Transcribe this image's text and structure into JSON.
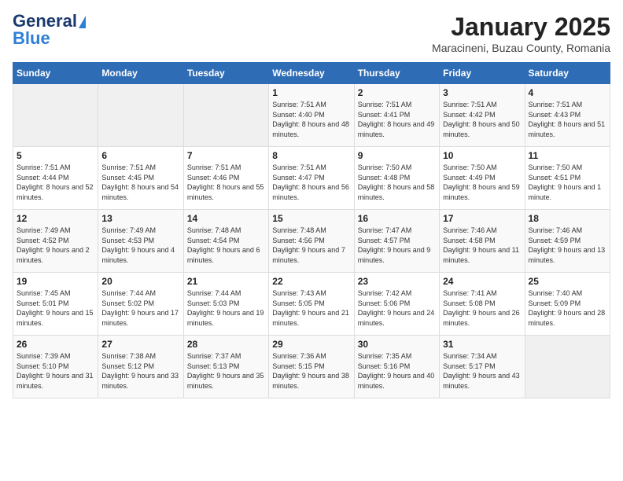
{
  "logo": {
    "text1": "General",
    "text2": "Blue"
  },
  "title": "January 2025",
  "subtitle": "Maracineni, Buzau County, Romania",
  "headers": [
    "Sunday",
    "Monday",
    "Tuesday",
    "Wednesday",
    "Thursday",
    "Friday",
    "Saturday"
  ],
  "weeks": [
    [
      {
        "day": "",
        "sunrise": "",
        "sunset": "",
        "daylight": ""
      },
      {
        "day": "",
        "sunrise": "",
        "sunset": "",
        "daylight": ""
      },
      {
        "day": "",
        "sunrise": "",
        "sunset": "",
        "daylight": ""
      },
      {
        "day": "1",
        "sunrise": "Sunrise: 7:51 AM",
        "sunset": "Sunset: 4:40 PM",
        "daylight": "Daylight: 8 hours and 48 minutes."
      },
      {
        "day": "2",
        "sunrise": "Sunrise: 7:51 AM",
        "sunset": "Sunset: 4:41 PM",
        "daylight": "Daylight: 8 hours and 49 minutes."
      },
      {
        "day": "3",
        "sunrise": "Sunrise: 7:51 AM",
        "sunset": "Sunset: 4:42 PM",
        "daylight": "Daylight: 8 hours and 50 minutes."
      },
      {
        "day": "4",
        "sunrise": "Sunrise: 7:51 AM",
        "sunset": "Sunset: 4:43 PM",
        "daylight": "Daylight: 8 hours and 51 minutes."
      }
    ],
    [
      {
        "day": "5",
        "sunrise": "Sunrise: 7:51 AM",
        "sunset": "Sunset: 4:44 PM",
        "daylight": "Daylight: 8 hours and 52 minutes."
      },
      {
        "day": "6",
        "sunrise": "Sunrise: 7:51 AM",
        "sunset": "Sunset: 4:45 PM",
        "daylight": "Daylight: 8 hours and 54 minutes."
      },
      {
        "day": "7",
        "sunrise": "Sunrise: 7:51 AM",
        "sunset": "Sunset: 4:46 PM",
        "daylight": "Daylight: 8 hours and 55 minutes."
      },
      {
        "day": "8",
        "sunrise": "Sunrise: 7:51 AM",
        "sunset": "Sunset: 4:47 PM",
        "daylight": "Daylight: 8 hours and 56 minutes."
      },
      {
        "day": "9",
        "sunrise": "Sunrise: 7:50 AM",
        "sunset": "Sunset: 4:48 PM",
        "daylight": "Daylight: 8 hours and 58 minutes."
      },
      {
        "day": "10",
        "sunrise": "Sunrise: 7:50 AM",
        "sunset": "Sunset: 4:49 PM",
        "daylight": "Daylight: 8 hours and 59 minutes."
      },
      {
        "day": "11",
        "sunrise": "Sunrise: 7:50 AM",
        "sunset": "Sunset: 4:51 PM",
        "daylight": "Daylight: 9 hours and 1 minute."
      }
    ],
    [
      {
        "day": "12",
        "sunrise": "Sunrise: 7:49 AM",
        "sunset": "Sunset: 4:52 PM",
        "daylight": "Daylight: 9 hours and 2 minutes."
      },
      {
        "day": "13",
        "sunrise": "Sunrise: 7:49 AM",
        "sunset": "Sunset: 4:53 PM",
        "daylight": "Daylight: 9 hours and 4 minutes."
      },
      {
        "day": "14",
        "sunrise": "Sunrise: 7:48 AM",
        "sunset": "Sunset: 4:54 PM",
        "daylight": "Daylight: 9 hours and 6 minutes."
      },
      {
        "day": "15",
        "sunrise": "Sunrise: 7:48 AM",
        "sunset": "Sunset: 4:56 PM",
        "daylight": "Daylight: 9 hours and 7 minutes."
      },
      {
        "day": "16",
        "sunrise": "Sunrise: 7:47 AM",
        "sunset": "Sunset: 4:57 PM",
        "daylight": "Daylight: 9 hours and 9 minutes."
      },
      {
        "day": "17",
        "sunrise": "Sunrise: 7:46 AM",
        "sunset": "Sunset: 4:58 PM",
        "daylight": "Daylight: 9 hours and 11 minutes."
      },
      {
        "day": "18",
        "sunrise": "Sunrise: 7:46 AM",
        "sunset": "Sunset: 4:59 PM",
        "daylight": "Daylight: 9 hours and 13 minutes."
      }
    ],
    [
      {
        "day": "19",
        "sunrise": "Sunrise: 7:45 AM",
        "sunset": "Sunset: 5:01 PM",
        "daylight": "Daylight: 9 hours and 15 minutes."
      },
      {
        "day": "20",
        "sunrise": "Sunrise: 7:44 AM",
        "sunset": "Sunset: 5:02 PM",
        "daylight": "Daylight: 9 hours and 17 minutes."
      },
      {
        "day": "21",
        "sunrise": "Sunrise: 7:44 AM",
        "sunset": "Sunset: 5:03 PM",
        "daylight": "Daylight: 9 hours and 19 minutes."
      },
      {
        "day": "22",
        "sunrise": "Sunrise: 7:43 AM",
        "sunset": "Sunset: 5:05 PM",
        "daylight": "Daylight: 9 hours and 21 minutes."
      },
      {
        "day": "23",
        "sunrise": "Sunrise: 7:42 AM",
        "sunset": "Sunset: 5:06 PM",
        "daylight": "Daylight: 9 hours and 24 minutes."
      },
      {
        "day": "24",
        "sunrise": "Sunrise: 7:41 AM",
        "sunset": "Sunset: 5:08 PM",
        "daylight": "Daylight: 9 hours and 26 minutes."
      },
      {
        "day": "25",
        "sunrise": "Sunrise: 7:40 AM",
        "sunset": "Sunset: 5:09 PM",
        "daylight": "Daylight: 9 hours and 28 minutes."
      }
    ],
    [
      {
        "day": "26",
        "sunrise": "Sunrise: 7:39 AM",
        "sunset": "Sunset: 5:10 PM",
        "daylight": "Daylight: 9 hours and 31 minutes."
      },
      {
        "day": "27",
        "sunrise": "Sunrise: 7:38 AM",
        "sunset": "Sunset: 5:12 PM",
        "daylight": "Daylight: 9 hours and 33 minutes."
      },
      {
        "day": "28",
        "sunrise": "Sunrise: 7:37 AM",
        "sunset": "Sunset: 5:13 PM",
        "daylight": "Daylight: 9 hours and 35 minutes."
      },
      {
        "day": "29",
        "sunrise": "Sunrise: 7:36 AM",
        "sunset": "Sunset: 5:15 PM",
        "daylight": "Daylight: 9 hours and 38 minutes."
      },
      {
        "day": "30",
        "sunrise": "Sunrise: 7:35 AM",
        "sunset": "Sunset: 5:16 PM",
        "daylight": "Daylight: 9 hours and 40 minutes."
      },
      {
        "day": "31",
        "sunrise": "Sunrise: 7:34 AM",
        "sunset": "Sunset: 5:17 PM",
        "daylight": "Daylight: 9 hours and 43 minutes."
      },
      {
        "day": "",
        "sunrise": "",
        "sunset": "",
        "daylight": ""
      }
    ]
  ]
}
